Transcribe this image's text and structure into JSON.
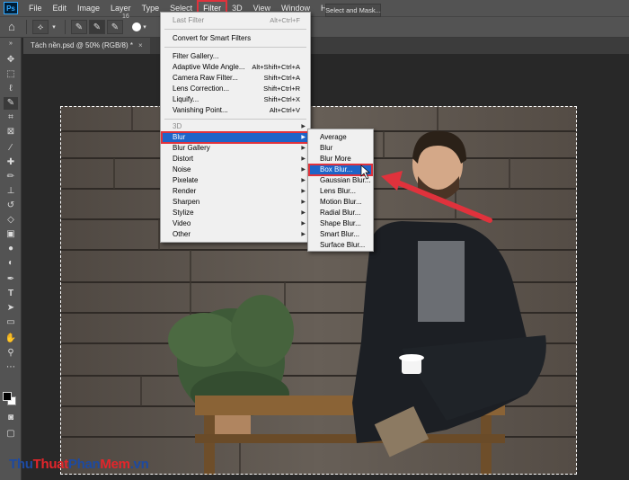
{
  "app": {
    "logo": "Ps"
  },
  "menubar": {
    "items": [
      "File",
      "Edit",
      "Image",
      "Layer",
      "Type",
      "Select",
      "Filter",
      "3D",
      "View",
      "Window",
      "Help"
    ],
    "active": "Filter"
  },
  "options": {
    "brush_size": "16",
    "sample_label": "S",
    "select_mask": "Select and Mask..."
  },
  "document": {
    "tab_title": "Tách nền.psd @ 50% (RGB/8) *",
    "close": "×"
  },
  "filter_menu": {
    "last_filter": {
      "label": "Last Filter",
      "shortcut": "Alt+Ctrl+F"
    },
    "convert": "Convert for Smart Filters",
    "group2": [
      {
        "label": "Filter Gallery...",
        "shortcut": ""
      },
      {
        "label": "Adaptive Wide Angle...",
        "shortcut": "Alt+Shift+Ctrl+A"
      },
      {
        "label": "Camera Raw Filter...",
        "shortcut": "Shift+Ctrl+A"
      },
      {
        "label": "Lens Correction...",
        "shortcut": "Shift+Ctrl+R"
      },
      {
        "label": "Liquify...",
        "shortcut": "Shift+Ctrl+X"
      },
      {
        "label": "Vanishing Point...",
        "shortcut": "Alt+Ctrl+V"
      }
    ],
    "submenus": [
      "3D",
      "Blur",
      "Blur Gallery",
      "Distort",
      "Noise",
      "Pixelate",
      "Render",
      "Sharpen",
      "Stylize",
      "Video",
      "Other"
    ],
    "highlighted": "Blur"
  },
  "blur_submenu": {
    "items": [
      "Average",
      "Blur",
      "Blur More",
      "Box Blur...",
      "Gaussian Blur...",
      "Lens Blur...",
      "Motion Blur...",
      "Radial Blur...",
      "Shape Blur...",
      "Smart Blur...",
      "Surface Blur..."
    ],
    "highlighted": "Box Blur..."
  },
  "watermark": {
    "part1": "Thu",
    "part2": "Thuat",
    "part3": "Phan",
    "part4": "Mem",
    "part5": ".vn"
  },
  "colors": {
    "accent": "#1e64c8",
    "annotation": "#e0323c",
    "panel": "#535353",
    "workspace": "#282828"
  }
}
